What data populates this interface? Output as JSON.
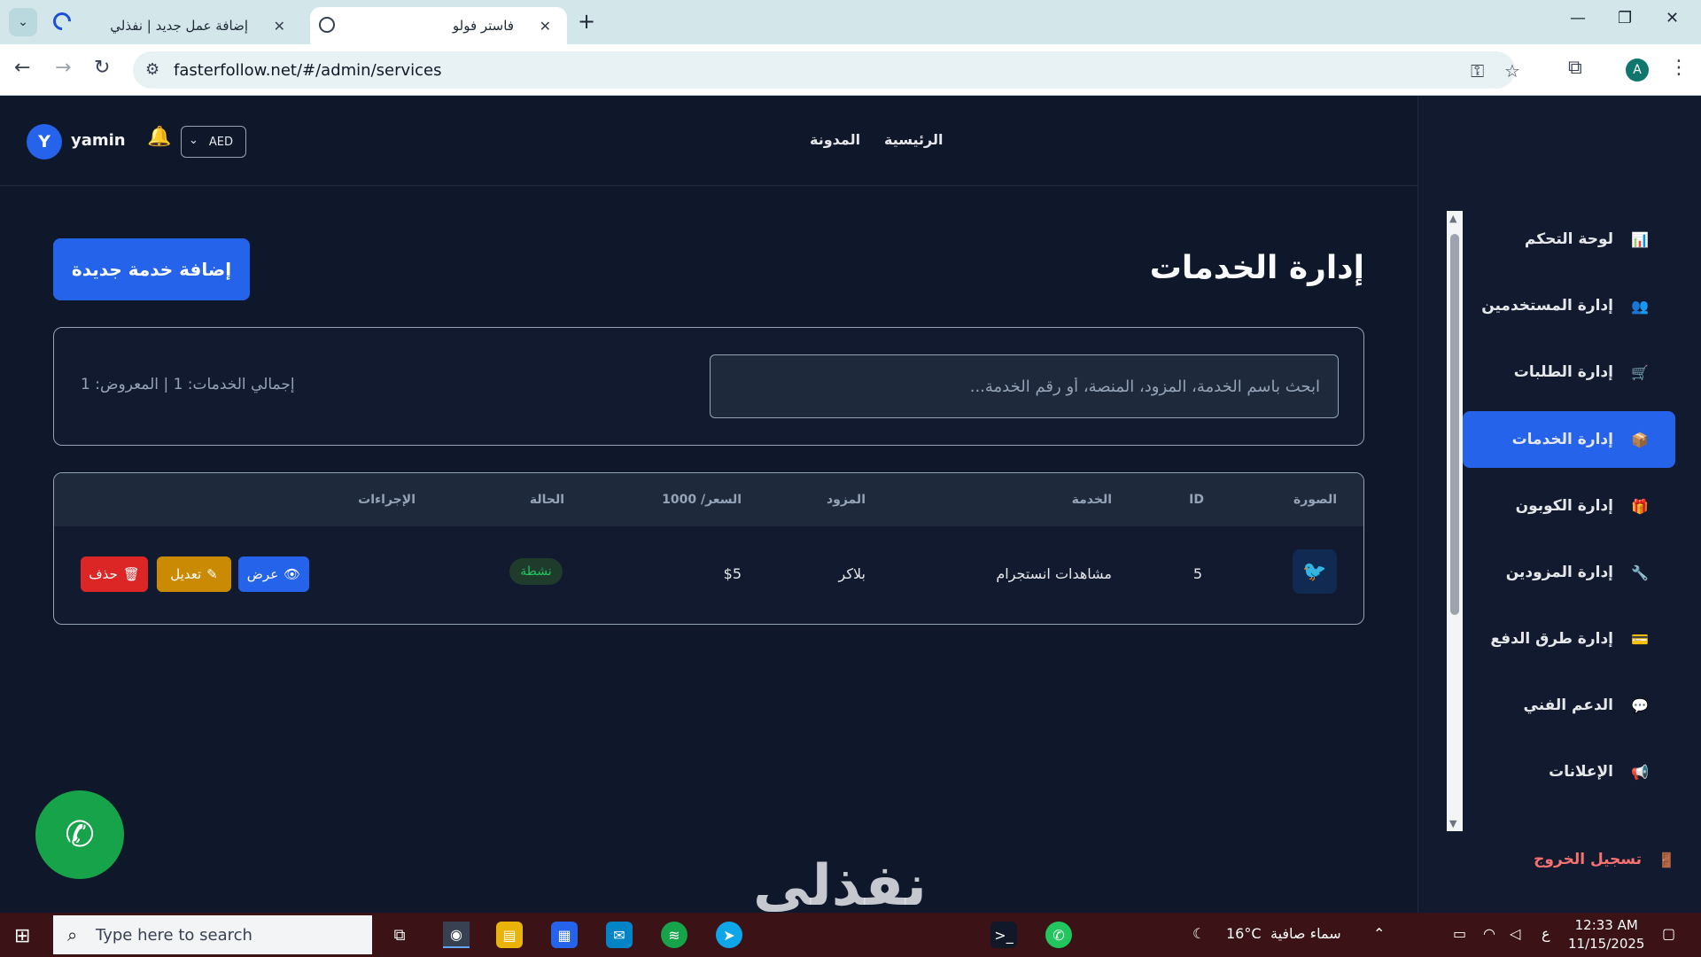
{
  "browser": {
    "tabs": [
      {
        "title": "إضافة عمل جديد | نفذلي",
        "close": "✕"
      },
      {
        "title": "فاستر فولو",
        "close": "✕"
      }
    ],
    "new_tab": "+",
    "url": "fasterfollow.net/#/admin/services",
    "profile_initial": "A"
  },
  "header": {
    "avatar_initial": "Y",
    "username": "yamin",
    "currency": "AED",
    "nav": [
      {
        "label": "الرئيسية"
      },
      {
        "label": "المدونة"
      }
    ]
  },
  "main": {
    "title": "إدارة الخدمات",
    "add_button": "إضافة خدمة جديدة",
    "search_placeholder": "ابحث باسم الخدمة، المزود، المنصة، أو رقم الخدمة...",
    "total_text": "إجمالي الخدمات: 1 | المعروض: 1",
    "table": {
      "headers": {
        "image": "الصورة",
        "id": "ID",
        "service": "الخدمة",
        "provider": "المزود",
        "price": "السعر/ 1000",
        "status": "الحالة",
        "actions": "الإجراءات"
      },
      "rows": [
        {
          "id": "5",
          "service": "مشاهدات انستجرام",
          "provider": "بلاكر",
          "price": "$5",
          "status": "نشطة",
          "view": "عرض",
          "edit": "تعديل",
          "delete": "حذف"
        }
      ]
    }
  },
  "sidebar": {
    "items": [
      {
        "label": "لوحة التحكم",
        "icon": "chart-icon"
      },
      {
        "label": "إدارة المستخدمين",
        "icon": "users-icon"
      },
      {
        "label": "إدارة الطلبات",
        "icon": "cart-icon"
      },
      {
        "label": "إدارة الخدمات",
        "icon": "package-icon"
      },
      {
        "label": "إدارة الكوبون",
        "icon": "gift-icon"
      },
      {
        "label": "إدارة المزودين",
        "icon": "tool-icon"
      },
      {
        "label": "إدارة طرق الدفع",
        "icon": "card-icon"
      },
      {
        "label": "الدعم الفني",
        "icon": "chat-icon"
      },
      {
        "label": "الإعلانات",
        "icon": "megaphone-icon"
      }
    ],
    "logout": "تسجيل الخروج"
  },
  "watermark": "نفذلي",
  "taskbar": {
    "search_placeholder": "Type here to search",
    "weather_temp": "16°C",
    "weather_text": "سماء صافية",
    "lang": "ع",
    "time": "12:33 AM",
    "date": "11/15/2025"
  }
}
